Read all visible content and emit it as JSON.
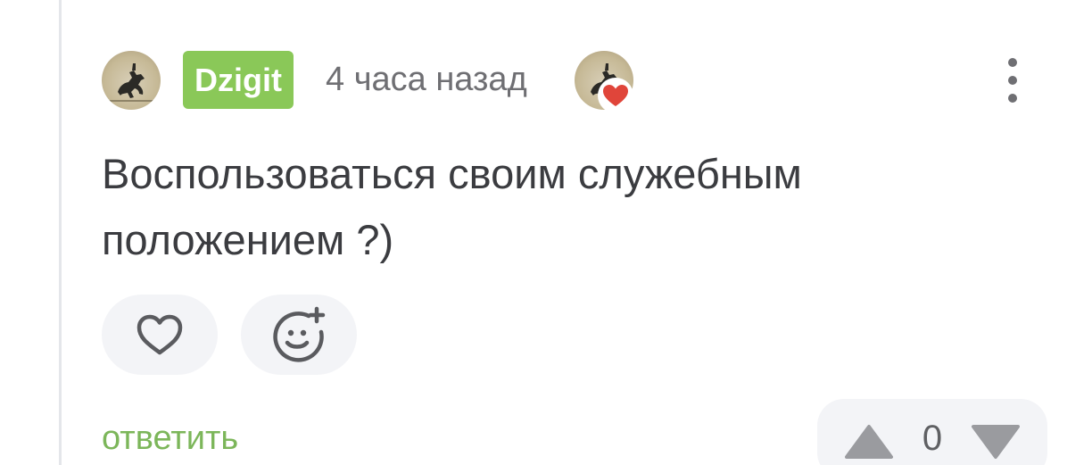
{
  "comment": {
    "author": "Dzigit",
    "time": "4 часа назад",
    "text": "Воспользоваться своим служебным положением ?)",
    "reply_label": "ответить",
    "rating": "0"
  },
  "icons": {
    "avatar": "horse-rider-avatar",
    "liked_by_author": "heart-badge-icon",
    "menu": "more-vertical-icon",
    "like": "heart-outline-icon",
    "emoji": "emoji-add-icon",
    "vote_up": "triangle-up-icon",
    "vote_down": "triangle-down-icon"
  },
  "colors": {
    "username_bg": "#8ac858",
    "reply_link": "#7cb65a",
    "heart_badge": "#e0453a",
    "button_bg": "#f3f4f7"
  }
}
